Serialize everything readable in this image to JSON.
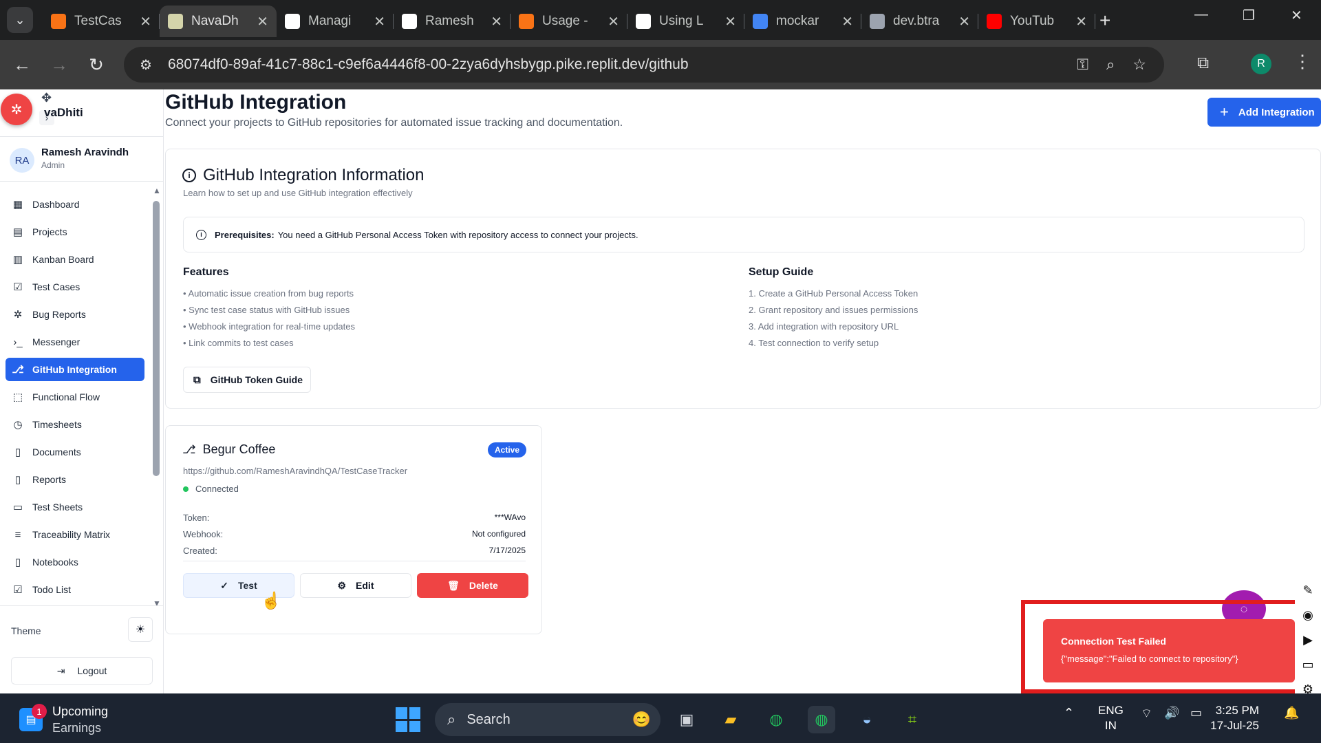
{
  "browser": {
    "tabs": [
      {
        "label": "TestCas",
        "favicon_color": "#f97316",
        "active": false
      },
      {
        "label": "NavaDh",
        "favicon_color": "#d4d4aa",
        "active": true
      },
      {
        "label": "Managi",
        "favicon_color": "#ffffff",
        "active": false
      },
      {
        "label": "Ramesh",
        "favicon_color": "#ffffff",
        "active": false
      },
      {
        "label": "Usage -",
        "favicon_color": "#f97316",
        "active": false
      },
      {
        "label": "Using L",
        "favicon_color": "#ffffff",
        "active": false
      },
      {
        "label": "mockar",
        "favicon_color": "#4285f4",
        "active": false
      },
      {
        "label": "dev.btra",
        "favicon_color": "#9ca3af",
        "active": false
      },
      {
        "label": "YouTub",
        "favicon_color": "#ff0000",
        "active": false
      }
    ],
    "url": "68074df0-89af-41c7-88c1-c9ef6a4446f8-00-2zya6dyhsbygp.pike.replit.dev/github",
    "profile_initial": "R"
  },
  "sidebar": {
    "brand": "vaDhiti",
    "user": {
      "initials": "RA",
      "name": "Ramesh Aravindh",
      "role": "Admin"
    },
    "items": [
      {
        "label": "Dashboard",
        "icon": "grid-icon",
        "active": false
      },
      {
        "label": "Projects",
        "icon": "folder-icon",
        "active": false
      },
      {
        "label": "Kanban Board",
        "icon": "kanban-icon",
        "active": false
      },
      {
        "label": "Test Cases",
        "icon": "checkbox-icon",
        "active": false
      },
      {
        "label": "Bug Reports",
        "icon": "bug-icon",
        "active": false
      },
      {
        "label": "Messenger",
        "icon": "terminal-icon",
        "active": false
      },
      {
        "label": "GitHub Integration",
        "icon": "github-icon",
        "active": true
      },
      {
        "label": "Functional Flow",
        "icon": "dashed-square-icon",
        "active": false
      },
      {
        "label": "Timesheets",
        "icon": "clock-icon",
        "active": false
      },
      {
        "label": "Documents",
        "icon": "document-icon",
        "active": false
      },
      {
        "label": "Reports",
        "icon": "report-icon",
        "active": false
      },
      {
        "label": "Test Sheets",
        "icon": "sheet-icon",
        "active": false
      },
      {
        "label": "Traceability Matrix",
        "icon": "filter-icon",
        "active": false
      },
      {
        "label": "Notebooks",
        "icon": "notebook-icon",
        "active": false
      },
      {
        "label": "Todo List",
        "icon": "todo-icon",
        "active": false
      }
    ],
    "theme_label": "Theme",
    "logout_label": "Logout"
  },
  "page": {
    "title": "GitHub Integration",
    "subtitle": "Connect your projects to GitHub repositories for automated issue tracking and documentation.",
    "add_button": "Add Integration"
  },
  "info": {
    "title": "GitHub Integration Information",
    "subtitle": "Learn how to set up and use GitHub integration effectively",
    "prereq_label": "Prerequisites:",
    "prereq_text": "You need a GitHub Personal Access Token with repository access to connect your projects.",
    "features_title": "Features",
    "features": [
      "• Automatic issue creation from bug reports",
      "• Sync test case status with GitHub issues",
      "• Webhook integration for real-time updates",
      "• Link commits to test cases"
    ],
    "setup_title": "Setup Guide",
    "setup": [
      "1. Create a GitHub Personal Access Token",
      "2. Grant repository and issues permissions",
      "3. Add integration with repository URL",
      "4. Test connection to verify setup"
    ],
    "guide_button": "GitHub Token Guide"
  },
  "integration": {
    "name": "Begur Coffee",
    "status_badge": "Active",
    "repo_url": "https://github.com/RameshAravindhQA/TestCaseTracker",
    "connection": "Connected",
    "token_label": "Token:",
    "token_value": "***WAvo",
    "webhook_label": "Webhook:",
    "webhook_value": "Not configured",
    "created_label": "Created:",
    "created_value": "7/17/2025",
    "test_label": "Test",
    "edit_label": "Edit",
    "delete_label": "Delete"
  },
  "toast": {
    "title": "Connection Test Failed",
    "message": "{\"message\":\"Failed to connect to repository\"}"
  },
  "taskbar": {
    "weather_badge": "1",
    "weather_line1": "Upcoming",
    "weather_line2": "Earnings",
    "search_placeholder": "Search",
    "lang_line1": "ENG",
    "lang_line2": "IN",
    "time": "3:25 PM",
    "date": "17-Jul-25"
  }
}
